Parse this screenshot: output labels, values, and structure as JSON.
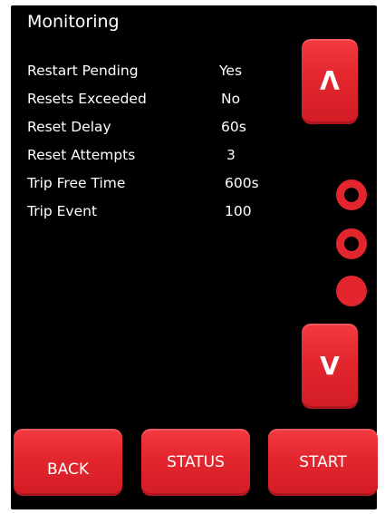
{
  "header": {
    "title": "Monitoring"
  },
  "parameters": [
    {
      "label": "Restart Pending",
      "value": "Yes"
    },
    {
      "label": "Resets Exceeded",
      "value": "No"
    },
    {
      "label": "Reset Delay",
      "value": "60s"
    },
    {
      "label": "Reset Attempts",
      "value": "3"
    },
    {
      "label": "Trip Free Time",
      "value": "600s"
    },
    {
      "label": "Trip Event",
      "value": "100"
    }
  ],
  "scroll": {
    "up_glyph": "Λ",
    "down_glyph": "V",
    "up_icon": "chevron-up-icon",
    "down_icon": "chevron-down-icon",
    "page_count": 3,
    "current_page": 3
  },
  "footer": {
    "back_label": "BACK",
    "status_label": "STATUS",
    "start_label": "START"
  },
  "colors": {
    "accent": "#e3262e",
    "background": "#000000",
    "text": "#ffffff"
  }
}
